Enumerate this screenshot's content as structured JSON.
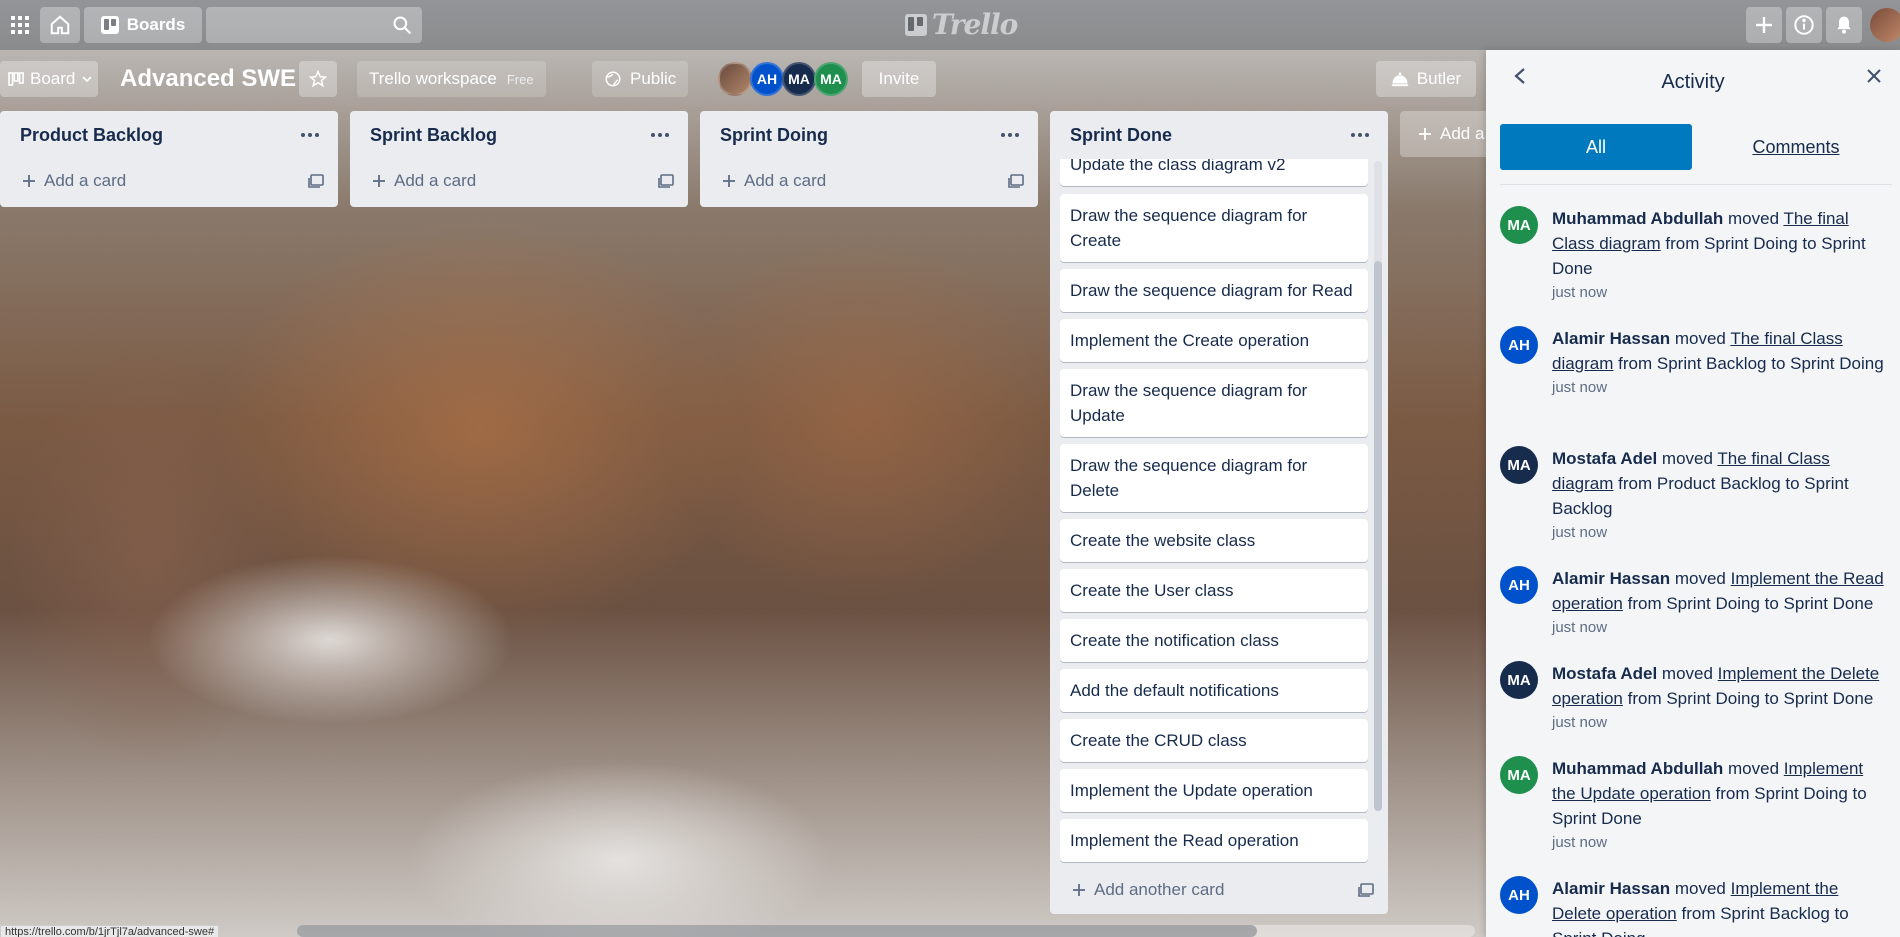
{
  "colors": {
    "accent": "#0079bf",
    "list_bg": "#ebecf0",
    "panel_bg": "#f4f5f7",
    "avatar_ah": "#0052cc",
    "avatar_ma_dark": "#172b4d",
    "avatar_ma_green": "#1f8f4e"
  },
  "topbar": {
    "boards_label": "Boards",
    "logo_text": "Trello",
    "icons": [
      "apps-icon",
      "home-icon",
      "board-icon",
      "search-icon",
      "plus-icon",
      "info-icon",
      "bell-icon"
    ]
  },
  "board": {
    "view_label": "Board",
    "title": "Advanced SWE",
    "workspace_label": "Trello workspace",
    "workspace_plan": "Free",
    "visibility_label": "Public",
    "members": [
      "AH",
      "MA",
      "MA"
    ],
    "invite_label": "Invite",
    "butler_label": "Butler"
  },
  "lists": [
    {
      "title": "Product Backlog",
      "add_label": "Add a card"
    },
    {
      "title": "Sprint Backlog",
      "add_label": "Add a card"
    },
    {
      "title": "Sprint Doing",
      "add_label": "Add a card"
    },
    {
      "title": "Sprint Done",
      "add_label": "Add another card",
      "cards": [
        "Update the class diagram v2",
        "Draw the sequence diagram for Create",
        "Draw the sequence diagram for Read",
        "Implement the Create operation",
        "Draw the sequence diagram for Update",
        "Draw the sequence diagram for Delete",
        "Create the website class",
        "Create the User class",
        "Create the notification class",
        "Add the default notifications",
        "Create the CRUD class",
        "Implement the Update operation",
        "Implement the Read operation"
      ]
    }
  ],
  "add_list_label": "Add a",
  "activity": {
    "title": "Activity",
    "tab_all": "All",
    "tab_comments": "Comments",
    "items": [
      {
        "initials": "MA",
        "user": "Muhammad Abdullah",
        "verb": "moved",
        "card": "The final Class diagram",
        "detail": "from Sprint Doing to Sprint Done",
        "time": "just now"
      },
      {
        "initials": "AH",
        "user": "Alamir Hassan",
        "verb": "moved",
        "card": "The final Class diagram",
        "detail": "from Sprint Backlog to Sprint Doing",
        "time": "just now"
      },
      {
        "initials": "MA",
        "user": "Mostafa Adel",
        "verb": "moved",
        "card": "The final Class diagram",
        "detail": "from Product Backlog to Sprint Backlog",
        "time": "just now"
      },
      {
        "initials": "AH",
        "user": "Alamir Hassan",
        "verb": "moved",
        "card": "Implement the Read operation",
        "detail": "from Sprint Doing to Sprint Done",
        "time": "just now"
      },
      {
        "initials": "MA",
        "user": "Mostafa Adel",
        "verb": "moved",
        "card": "Implement the Delete operation",
        "detail": "from Sprint Doing to Sprint Done",
        "time": "just now"
      },
      {
        "initials": "MA",
        "user": "Muhammad Abdullah",
        "verb": "moved",
        "card": "Implement the Update operation",
        "detail": "from Sprint Doing to Sprint Done",
        "time": "just now"
      },
      {
        "initials": "AH",
        "user": "Alamir Hassan",
        "verb": "moved",
        "card": "Implement the Delete operation",
        "detail": "from Sprint Backlog to Sprint Doing",
        "time": ""
      }
    ]
  },
  "status_url": "https://trello.com/b/1jrTjl7a/advanced-swe#"
}
